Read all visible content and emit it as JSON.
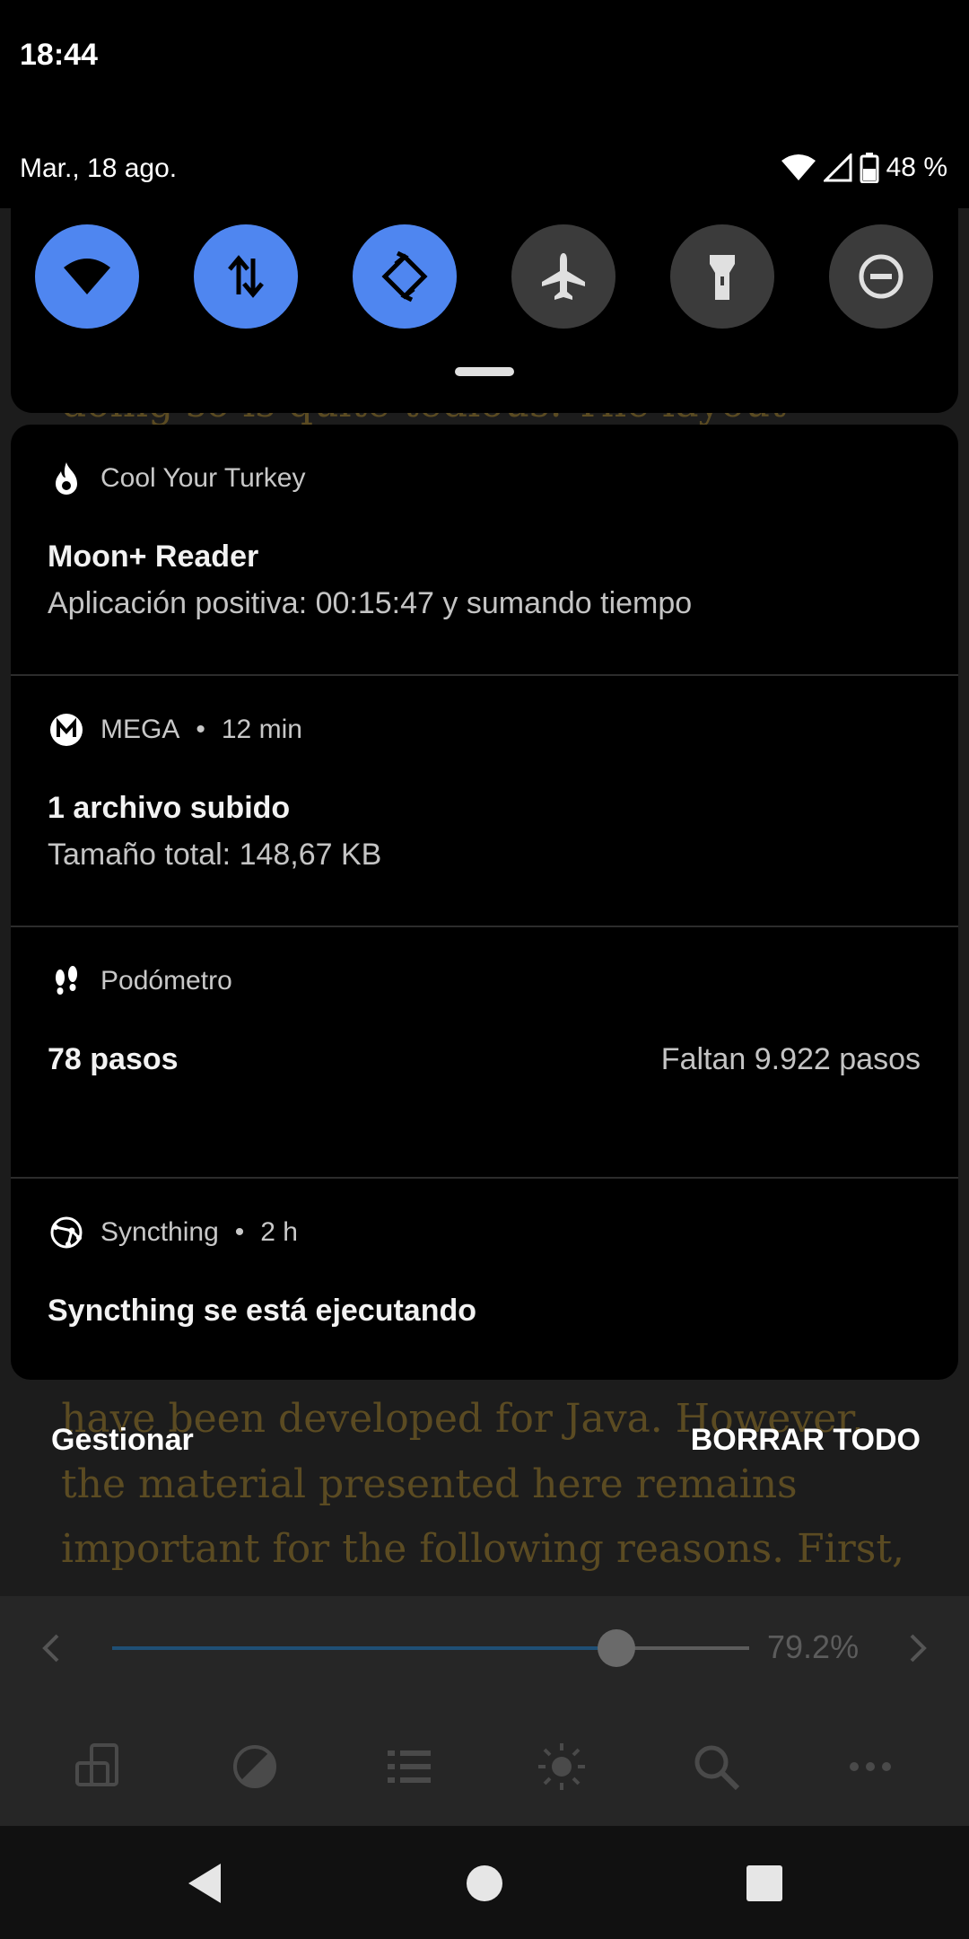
{
  "status_bar": {
    "time": "18:44",
    "date": "Mar., 18 ago.",
    "battery": "48 %",
    "icons": [
      "wifi-icon",
      "signal-icon",
      "battery-icon"
    ]
  },
  "quick_settings": [
    {
      "name": "wifi",
      "icon": "wifi-icon",
      "active": true
    },
    {
      "name": "mobile-data",
      "icon": "data-arrows-icon",
      "active": true
    },
    {
      "name": "auto-rotate",
      "icon": "rotate-icon",
      "active": true
    },
    {
      "name": "airplane-mode",
      "icon": "airplane-icon",
      "active": false
    },
    {
      "name": "flashlight",
      "icon": "flashlight-icon",
      "active": false
    },
    {
      "name": "do-not-disturb",
      "icon": "dnd-icon",
      "active": false
    }
  ],
  "notifications": [
    {
      "app": "Cool Your Turkey",
      "icon": "flame-icon",
      "title": "Moon+ Reader",
      "text": "Aplicación positiva: 00:15:47 y sumando tiempo"
    },
    {
      "app": "MEGA",
      "time": "12 min",
      "icon": "mega-icon",
      "title": "1 archivo subido",
      "text": "Tamaño total: 148,67 KB"
    },
    {
      "app": "Podómetro",
      "icon": "footprints-icon",
      "title": "78 pasos",
      "right_text": "Faltan 9.922 pasos",
      "progress": 0.0078
    },
    {
      "app": "Syncthing",
      "time": "2 h",
      "icon": "syncthing-icon",
      "title": "Syncthing se está ejecutando"
    }
  ],
  "shade_actions": {
    "manage": "Gestionar",
    "clear_all": "BORRAR TODO"
  },
  "reader": {
    "lines": [
      "doing so is quite tedious. The layout",
      "have been developed for Java. However,",
      "the material presented here remains",
      "important for the following reasons. First,"
    ],
    "progress_percent": 79.2,
    "progress_label": "79.2%",
    "toolbar_icons": [
      "screen-orientation-icon",
      "theme-contrast-icon",
      "list-icon",
      "brightness-icon",
      "search-icon",
      "more-icon"
    ]
  },
  "nav": {
    "icons": [
      "back-icon",
      "home-icon",
      "recents-icon"
    ]
  },
  "colors": {
    "accent": "#4f86f0",
    "tile_off": "#3b3b3b",
    "reader_text": "#5b4b22"
  }
}
